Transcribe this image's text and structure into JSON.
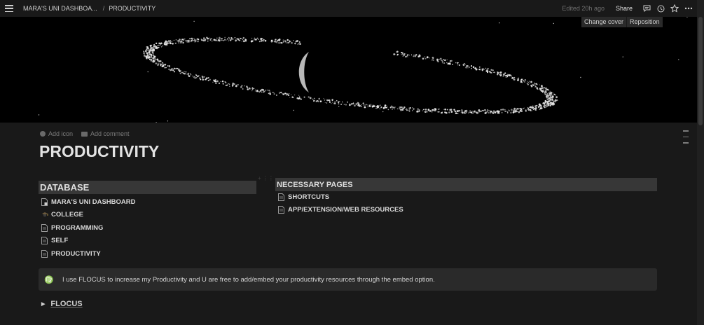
{
  "topbar": {
    "breadcrumb": [
      "MARA'S UNI DASHBOA...",
      "PRODUCTIVITY"
    ],
    "separator": "/",
    "edited": "Edited 20h ago",
    "share": "Share",
    "icons": [
      "comment-icon",
      "clock-icon",
      "star-icon",
      "more-icon"
    ]
  },
  "cover": {
    "change_cover": "Change cover",
    "reposition": "Reposition"
  },
  "page": {
    "add_icon": "Add icon",
    "add_comment": "Add comment",
    "title": "PRODUCTIVITY"
  },
  "database": {
    "heading": "DATABASE",
    "items": [
      {
        "label": "MARA'S UNI DASHBOARD",
        "icon": "page-icon"
      },
      {
        "label": "COLLEGE",
        "icon": "graduation-cap-icon"
      },
      {
        "label": "PROGRAMMING",
        "icon": "page-icon"
      },
      {
        "label": "SELF",
        "icon": "page-icon"
      },
      {
        "label": "PRODUCTIVITY",
        "icon": "page-icon"
      }
    ]
  },
  "necessary_pages": {
    "heading": "NECESSARY PAGES",
    "items": [
      {
        "label": "SHORTCUTS",
        "icon": "page-icon"
      },
      {
        "label": "APP/EXTENSION/WEB RESOURCES",
        "icon": "page-icon"
      }
    ]
  },
  "callout": {
    "icon": "♍",
    "text": "I use FLOCUS to increase my Productivity and U are free to add/embed your productivity resources through the embed option."
  },
  "toggle": {
    "label": "FLOCUS"
  },
  "colors": {
    "background": "#191919",
    "header_block": "#373737",
    "callout_bg": "#2a2a2a",
    "text": "#d4d4d4"
  }
}
